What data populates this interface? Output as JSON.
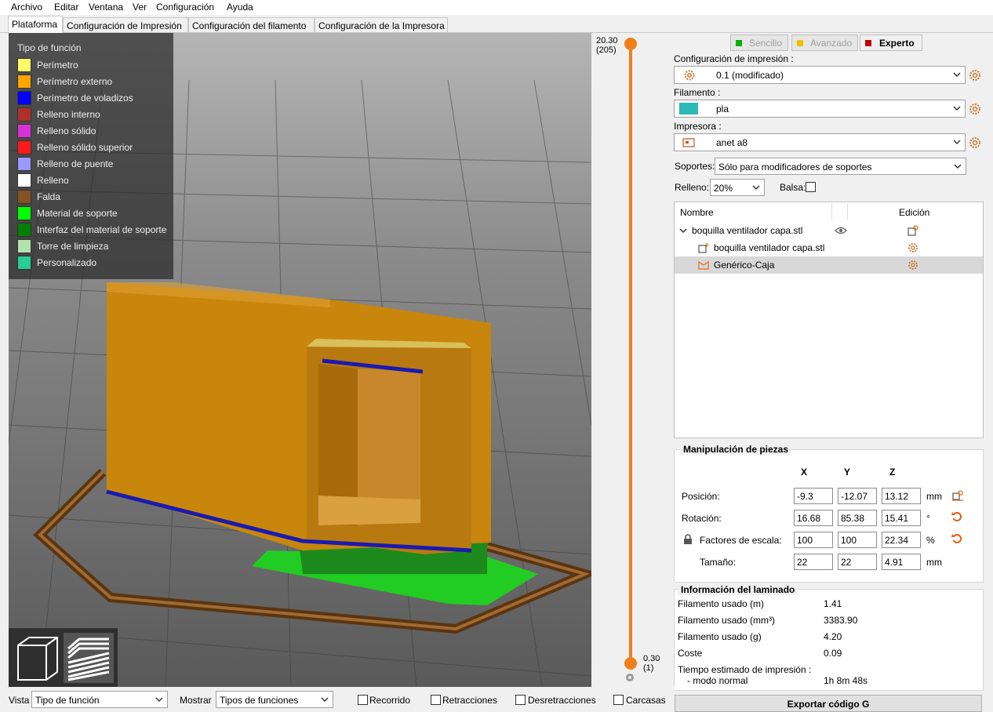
{
  "menu": [
    "Archivo",
    "Editar",
    "Ventana",
    "Ver",
    "Configuración",
    "Ayuda"
  ],
  "tabs": [
    "Plataforma",
    "Configuración de Impresión",
    "Configuración del filamento",
    "Configuración de la Impresora"
  ],
  "legend": {
    "title": "Tipo de función",
    "items": [
      {
        "label": "Perímetro",
        "color": "#ffff68"
      },
      {
        "label": "Perímetro externo",
        "color": "#ffa500"
      },
      {
        "label": "Perímetro de voladizos",
        "color": "#0000ff"
      },
      {
        "label": "Relleno interno",
        "color": "#b03029"
      },
      {
        "label": "Relleno sólido",
        "color": "#d732d7"
      },
      {
        "label": "Relleno sólido superior",
        "color": "#ff1a1a"
      },
      {
        "label": "Relleno de puente",
        "color": "#9999ff"
      },
      {
        "label": "Relleno",
        "color": "#ffffff"
      },
      {
        "label": "Falda",
        "color": "#845321"
      },
      {
        "label": "Material de soporte",
        "color": "#00ff00"
      },
      {
        "label": "Interfaz del material de soporte",
        "color": "#008000"
      },
      {
        "label": "Torre de limpieza",
        "color": "#b3e3ab"
      },
      {
        "label": "Personalizado",
        "color": "#28cc94"
      }
    ]
  },
  "slider": {
    "top_value": "20.30",
    "top_layer": "(205)",
    "bottom_value": "0.30",
    "bottom_layer": "(1)"
  },
  "modes": {
    "simple": "Sencillo",
    "advanced": "Avanzado",
    "expert": "Experto"
  },
  "print_settings": {
    "label": "Configuración de impresión :",
    "value": "0.1 (modificado)"
  },
  "filament": {
    "label": "Filamento :",
    "value": "pla",
    "color": "#2fb8b8"
  },
  "printer": {
    "label": "Impresora :",
    "value": "anet a8"
  },
  "supports": {
    "label": "Soportes:",
    "value": "Sólo para modificadores de soportes"
  },
  "infill": {
    "label": "Relleno:",
    "value": "20%"
  },
  "brim": {
    "label": "Balsa:"
  },
  "object_list": {
    "col_name": "Nombre",
    "col_edit": "Edición",
    "object": "boquilla ventilador capa.stl",
    "part": "boquilla ventilador capa.stl",
    "modifier": "Genérico-Caja"
  },
  "manipulation": {
    "title": "Manipulación de piezas",
    "axes": [
      "X",
      "Y",
      "Z"
    ],
    "position": {
      "label": "Posición:",
      "x": "-9.3",
      "y": "-12.07",
      "z": "13.12",
      "unit": "mm"
    },
    "rotation": {
      "label": "Rotación:",
      "x": "16.68",
      "y": "85.38",
      "z": "15.41",
      "unit": "°"
    },
    "scale": {
      "label": "Factores de escala:",
      "x": "100",
      "y": "100",
      "z": "22.34",
      "unit": "%"
    },
    "size": {
      "label": "Tamaño:",
      "x": "22",
      "y": "22",
      "z": "4.91",
      "unit": "mm"
    }
  },
  "slice_info": {
    "title": "Información del laminado",
    "rows": [
      {
        "label": "Filamento usado (m)",
        "value": "1.41"
      },
      {
        "label": "Filamento usado (mm³)",
        "value": "3383.90"
      },
      {
        "label": "Filamento usado (g)",
        "value": "4.20"
      },
      {
        "label": "Coste",
        "value": "0.09"
      }
    ],
    "time_label": "Tiempo estimado de impresión :",
    "mode_label": "- modo normal",
    "mode_value": "1h 8m 48s"
  },
  "bottom": {
    "view_label": "Vista",
    "view_value": "Tipo de función",
    "show_label": "Mostrar",
    "show_value": "Tipos de funciones",
    "checks": [
      "Recorrido",
      "Retracciones",
      "Desretracciones",
      "Carcasas"
    ]
  },
  "export_button": "Exportar código G"
}
